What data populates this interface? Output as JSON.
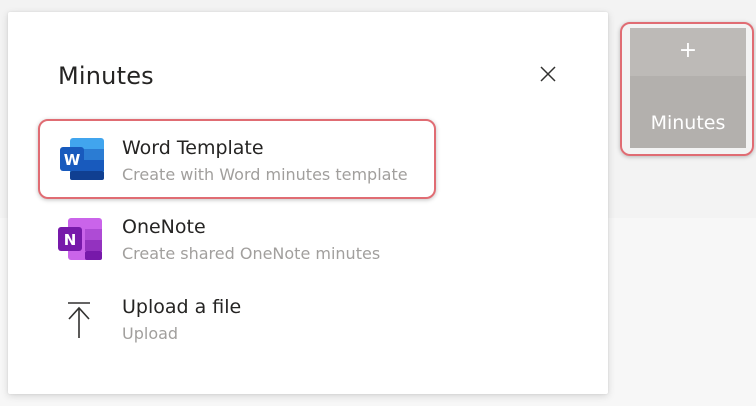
{
  "popup": {
    "title": "Minutes",
    "close_icon": "close-icon",
    "options": [
      {
        "icon": "word-icon",
        "title": "Word Template",
        "subtitle": "Create with Word minutes template"
      },
      {
        "icon": "onenote-icon",
        "title": "OneNote",
        "subtitle": "Create shared OneNote minutes"
      },
      {
        "icon": "upload-icon",
        "title": "Upload a file",
        "subtitle": "Upload"
      }
    ]
  },
  "tile": {
    "plus": "+",
    "label": "Minutes",
    "icon": "plus-icon"
  },
  "colors": {
    "highlight": "#e06c73",
    "tile_bg": "#b3b0ad",
    "word_blue": "#185abd",
    "onenote_purple": "#7719aa",
    "text_primary": "#252423",
    "text_secondary": "#a19f9d"
  }
}
